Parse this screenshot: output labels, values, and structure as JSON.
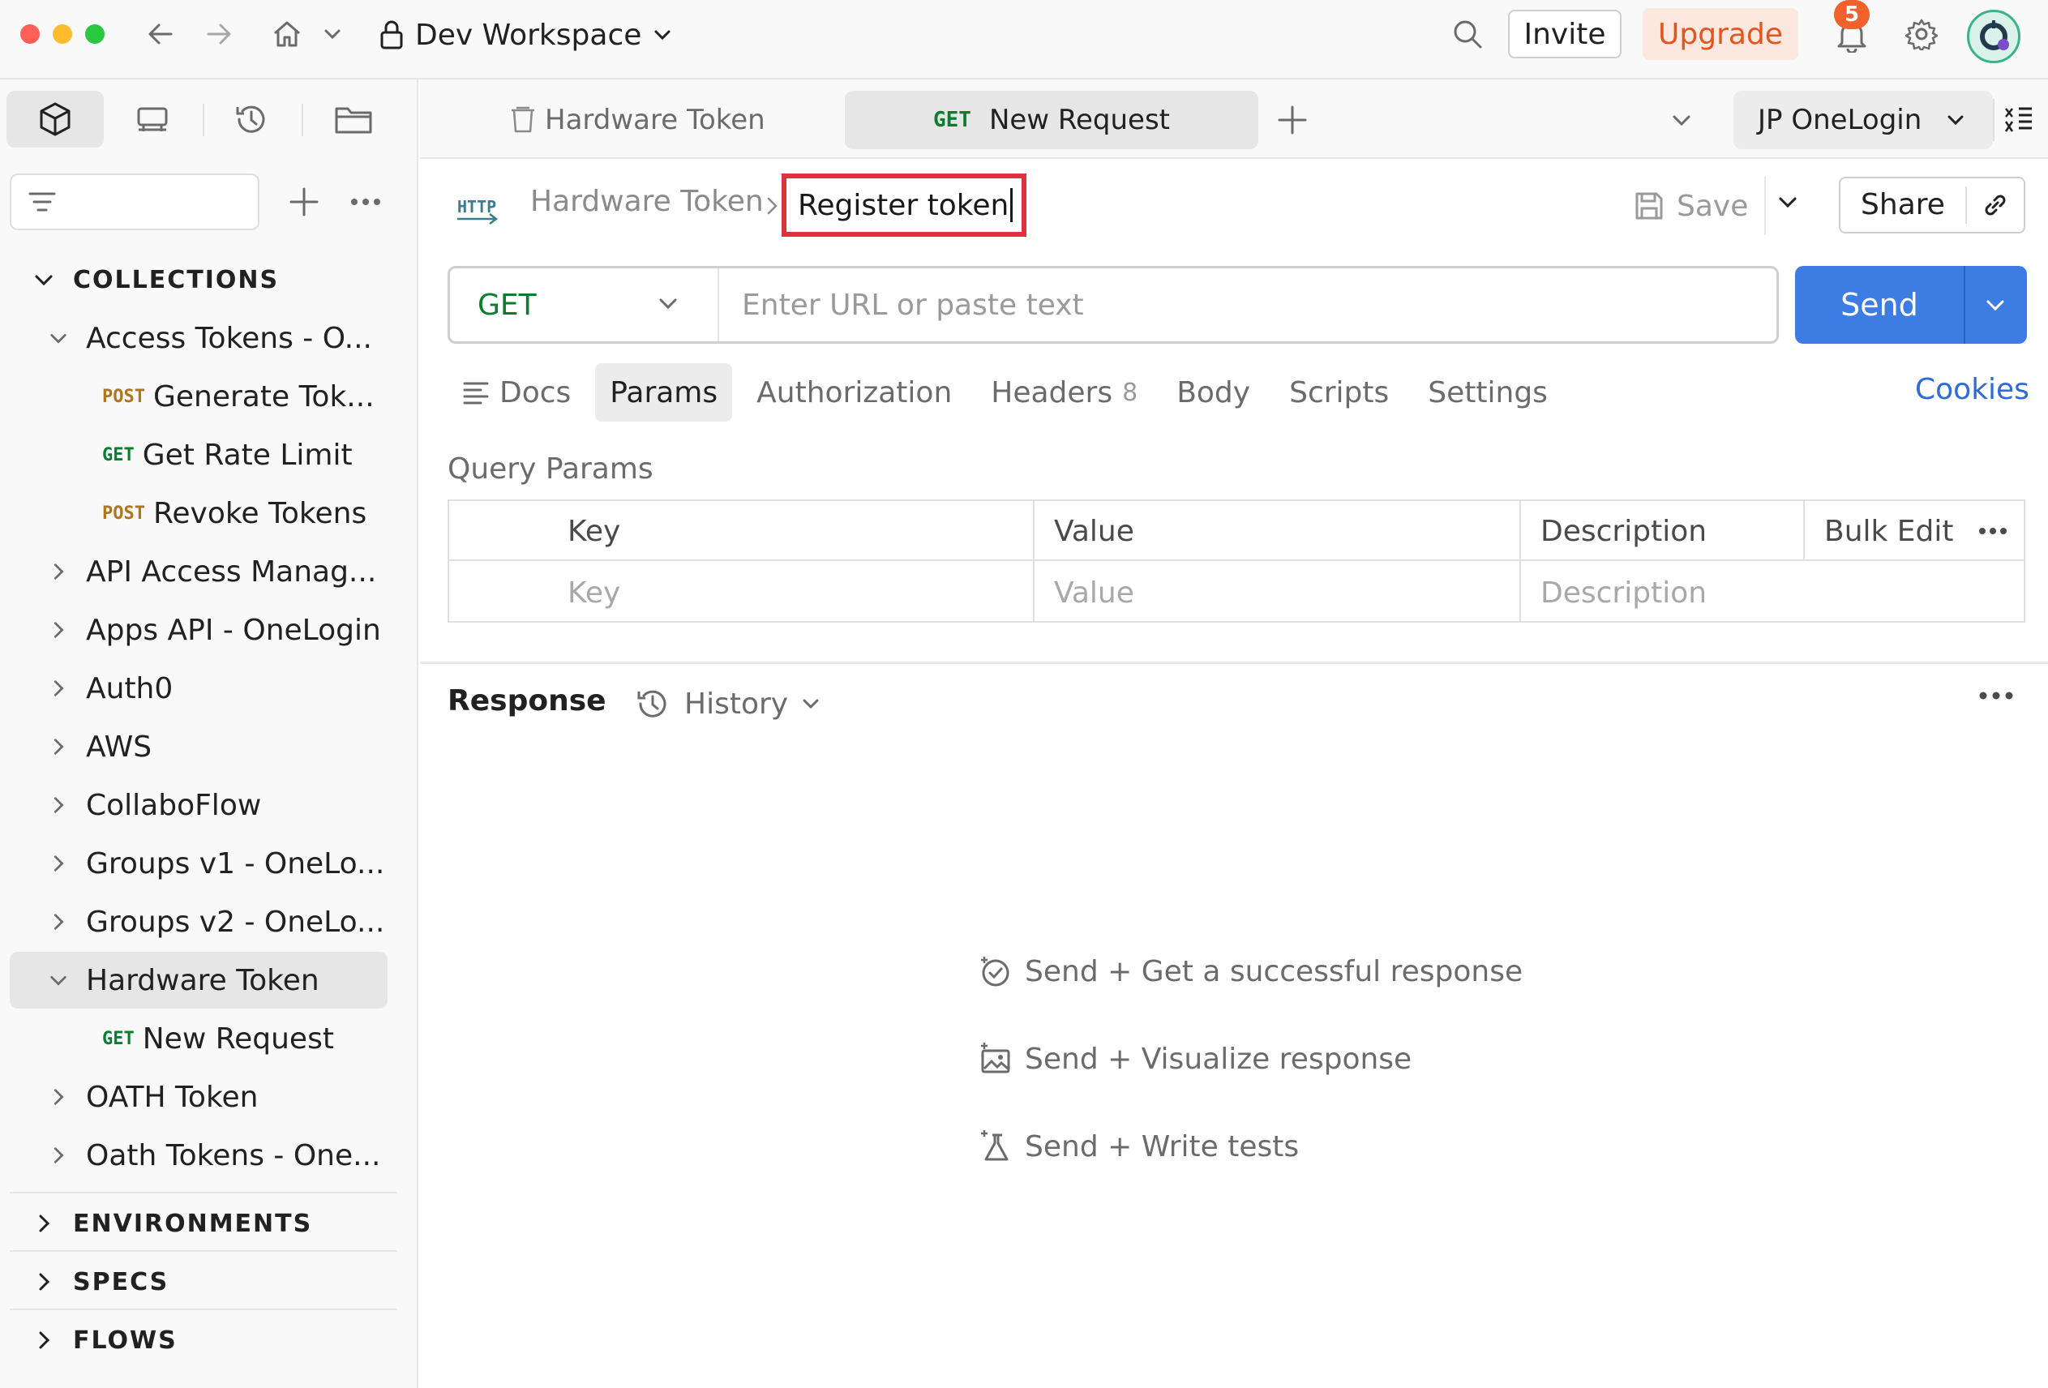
{
  "window": {
    "workspace_name": "Dev Workspace",
    "invite_label": "Invite",
    "upgrade_label": "Upgrade",
    "notification_count": "5"
  },
  "sidebar": {
    "sections": {
      "collections": "COLLECTIONS",
      "environments": "ENVIRONMENTS",
      "specs": "SPECS",
      "flows": "FLOWS"
    },
    "tree": [
      {
        "label": "Access Tokens - O...",
        "type": "folder",
        "expanded": true
      },
      {
        "label": "Generate Tok...",
        "type": "request",
        "method": "POST"
      },
      {
        "label": "Get Rate Limit",
        "type": "request",
        "method": "GET"
      },
      {
        "label": "Revoke Tokens",
        "type": "request",
        "method": "POST"
      },
      {
        "label": "API Access Manag...",
        "type": "folder",
        "expanded": false
      },
      {
        "label": "Apps API - OneLogin",
        "type": "folder",
        "expanded": false
      },
      {
        "label": "Auth0",
        "type": "folder",
        "expanded": false
      },
      {
        "label": "AWS",
        "type": "folder",
        "expanded": false
      },
      {
        "label": "CollaboFlow",
        "type": "folder",
        "expanded": false
      },
      {
        "label": "Groups v1 - OneLo...",
        "type": "folder",
        "expanded": false
      },
      {
        "label": "Groups v2 - OneLo...",
        "type": "folder",
        "expanded": false
      },
      {
        "label": "Hardware Token",
        "type": "folder",
        "expanded": true,
        "selected": true
      },
      {
        "label": "New Request",
        "type": "request",
        "method": "GET"
      },
      {
        "label": "OATH Token",
        "type": "folder",
        "expanded": false
      },
      {
        "label": "Oath Tokens - One...",
        "type": "folder",
        "expanded": false
      }
    ]
  },
  "tabs": [
    {
      "label": "Hardware Token",
      "icon": "collection-icon",
      "active": false
    },
    {
      "label": "New Request",
      "method": "GET",
      "active": true
    }
  ],
  "environment": {
    "selected": "JP OneLogin"
  },
  "request": {
    "breadcrumb_parent": "Hardware Token",
    "name_value": "Register token",
    "save_label": "Save",
    "share_label": "Share",
    "method": "GET",
    "url_placeholder": "Enter URL or paste text",
    "send_label": "Send"
  },
  "request_tabs": [
    {
      "label": "Docs",
      "active": false
    },
    {
      "label": "Params",
      "active": true
    },
    {
      "label": "Authorization",
      "active": false
    },
    {
      "label": "Headers",
      "count": "8",
      "active": false
    },
    {
      "label": "Body",
      "active": false
    },
    {
      "label": "Scripts",
      "active": false
    },
    {
      "label": "Settings",
      "active": false
    }
  ],
  "cookies_label": "Cookies",
  "query_params": {
    "title": "Query Params",
    "headers": {
      "key": "Key",
      "value": "Value",
      "description": "Description",
      "bulk_edit": "Bulk Edit"
    },
    "placeholders": {
      "key": "Key",
      "value": "Value",
      "description": "Description"
    }
  },
  "response": {
    "title": "Response",
    "history_label": "History",
    "hints": [
      "Send + Get a successful response",
      "Send + Visualize response",
      "Send + Write tests"
    ]
  },
  "colors": {
    "accent": "#3d7de3",
    "get_method": "#0a7d2e",
    "post_method": "#b0741a",
    "upgrade": "#e2561d",
    "highlight_box": "#e0323c"
  }
}
